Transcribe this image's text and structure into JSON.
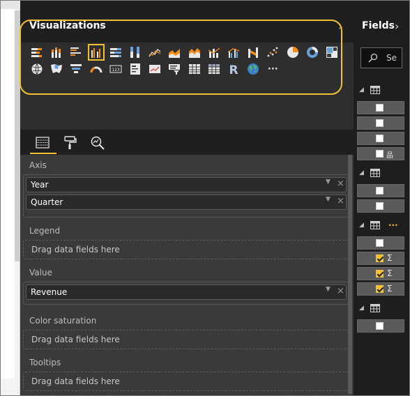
{
  "visualizations": {
    "title": "Visualizations",
    "collapse_glyph": "›",
    "row1_icons": [
      "stacked-bar-chart-icon",
      "stacked-column-chart-icon",
      "clustered-bar-chart-icon",
      "clustered-column-chart-icon",
      "100-stacked-bar-chart-icon",
      "100-stacked-column-chart-icon",
      "line-chart-icon",
      "area-chart-icon",
      "stacked-area-chart-icon",
      "line-stacked-column-chart-icon",
      "line-clustered-column-chart-icon",
      "ribbon-chart-icon",
      "scatter-chart-icon",
      "pie-chart-icon",
      "donut-chart-icon",
      "treemap-icon"
    ],
    "row2_icons": [
      "map-icon",
      "filled-map-icon",
      "funnel-icon",
      "gauge-icon",
      "card-icon",
      "multi-row-card-icon",
      "kpi-icon",
      "slicer-icon",
      "table-icon",
      "matrix-icon",
      "r-script-visual-icon",
      "globe-map-icon",
      "more-visuals-icon"
    ],
    "r_label": "R",
    "more_label": "···",
    "selected": "clustered-column-chart-icon"
  },
  "tabs": [
    "fields-tab",
    "format-tab",
    "analytics-tab"
  ],
  "wells": {
    "axis": {
      "label": "Axis",
      "fields": [
        "Year",
        "Quarter"
      ]
    },
    "legend": {
      "label": "Legend",
      "placeholder": "Drag data fields here"
    },
    "value": {
      "label": "Value",
      "fields": [
        "Revenue"
      ]
    },
    "color_saturation": {
      "label": "Color saturation",
      "placeholder": "Drag data fields here"
    },
    "tooltips": {
      "label": "Tooltips",
      "placeholder": "Drag data fields here"
    },
    "remove_glyph": "×",
    "dropdown_glyph": "▼"
  },
  "fields": {
    "title": "Fields",
    "collapse_glyph": "›",
    "search_placeholder": "Se",
    "table_expand_glyph": "◢",
    "ellipsis": "...",
    "sigma": "Σ",
    "hierarchy_glyph": "品"
  },
  "colors": {
    "accent": "#f2c232",
    "pane_bg": "#3a3a3a",
    "header_bg": "#1f1f1f"
  }
}
